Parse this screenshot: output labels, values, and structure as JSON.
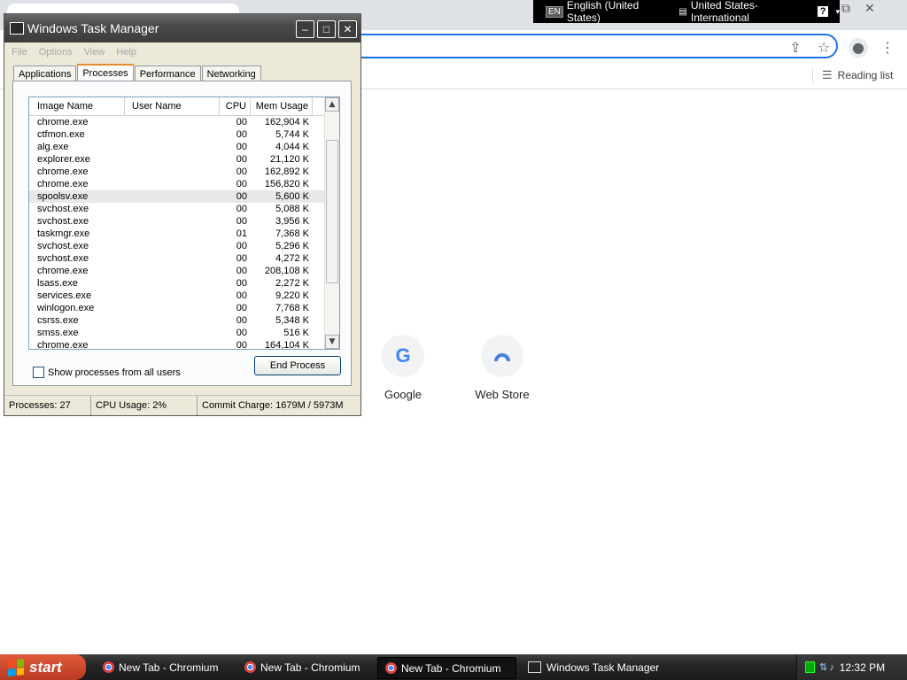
{
  "browser": {
    "reading_list_label": "Reading list",
    "shortcuts": [
      {
        "label": "Google"
      },
      {
        "label": "Web Store"
      }
    ]
  },
  "language_bar": {
    "lang_code": "EN",
    "language": "English (United States)",
    "keyboard": "United States-International",
    "help": "?"
  },
  "task_manager": {
    "title": "Windows Task Manager",
    "menu": [
      "File",
      "Options",
      "View",
      "Help"
    ],
    "tabs": [
      "Applications",
      "Processes",
      "Performance",
      "Networking"
    ],
    "active_tab": "Processes",
    "columns": {
      "image_name": "Image Name",
      "user_name": "User Name",
      "cpu": "CPU",
      "mem": "Mem Usage"
    },
    "processes": [
      {
        "name": "chrome.exe",
        "user": "",
        "cpu": "00",
        "mem": "162,904 K"
      },
      {
        "name": "ctfmon.exe",
        "user": "",
        "cpu": "00",
        "mem": "5,744 K"
      },
      {
        "name": "alg.exe",
        "user": "",
        "cpu": "00",
        "mem": "4,044 K"
      },
      {
        "name": "explorer.exe",
        "user": "",
        "cpu": "00",
        "mem": "21,120 K"
      },
      {
        "name": "chrome.exe",
        "user": "",
        "cpu": "00",
        "mem": "162,892 K"
      },
      {
        "name": "chrome.exe",
        "user": "",
        "cpu": "00",
        "mem": "156,820 K"
      },
      {
        "name": "spoolsv.exe",
        "user": "",
        "cpu": "00",
        "mem": "5,600 K"
      },
      {
        "name": "svchost.exe",
        "user": "",
        "cpu": "00",
        "mem": "5,088 K"
      },
      {
        "name": "svchost.exe",
        "user": "",
        "cpu": "00",
        "mem": "3,956 K"
      },
      {
        "name": "taskmgr.exe",
        "user": "",
        "cpu": "01",
        "mem": "7,368 K"
      },
      {
        "name": "svchost.exe",
        "user": "",
        "cpu": "00",
        "mem": "5,296 K"
      },
      {
        "name": "svchost.exe",
        "user": "",
        "cpu": "00",
        "mem": "4,272 K"
      },
      {
        "name": "chrome.exe",
        "user": "",
        "cpu": "00",
        "mem": "208,108 K"
      },
      {
        "name": "lsass.exe",
        "user": "",
        "cpu": "00",
        "mem": "2,272 K"
      },
      {
        "name": "services.exe",
        "user": "",
        "cpu": "00",
        "mem": "9,220 K"
      },
      {
        "name": "winlogon.exe",
        "user": "",
        "cpu": "00",
        "mem": "7,768 K"
      },
      {
        "name": "csrss.exe",
        "user": "",
        "cpu": "00",
        "mem": "5,348 K"
      },
      {
        "name": "smss.exe",
        "user": "",
        "cpu": "00",
        "mem": "516 K"
      },
      {
        "name": "chrome.exe",
        "user": "",
        "cpu": "00",
        "mem": "164,104 K"
      }
    ],
    "selected_index": 6,
    "show_all_label": "Show processes from all users",
    "end_process_label": "End Process",
    "status": {
      "processes": "Processes: 27",
      "cpu_usage": "CPU Usage: 2%",
      "commit_charge": "Commit Charge: 1679M / 5973M"
    }
  },
  "taskbar": {
    "start_label": "start",
    "tasks": [
      {
        "label": "New Tab - Chromium",
        "active": false
      },
      {
        "label": "New Tab - Chromium",
        "active": false
      },
      {
        "label": "New Tab - Chromium",
        "active": true
      },
      {
        "label": "Windows Task Manager",
        "active": false
      }
    ],
    "clock": "12:32 PM"
  }
}
